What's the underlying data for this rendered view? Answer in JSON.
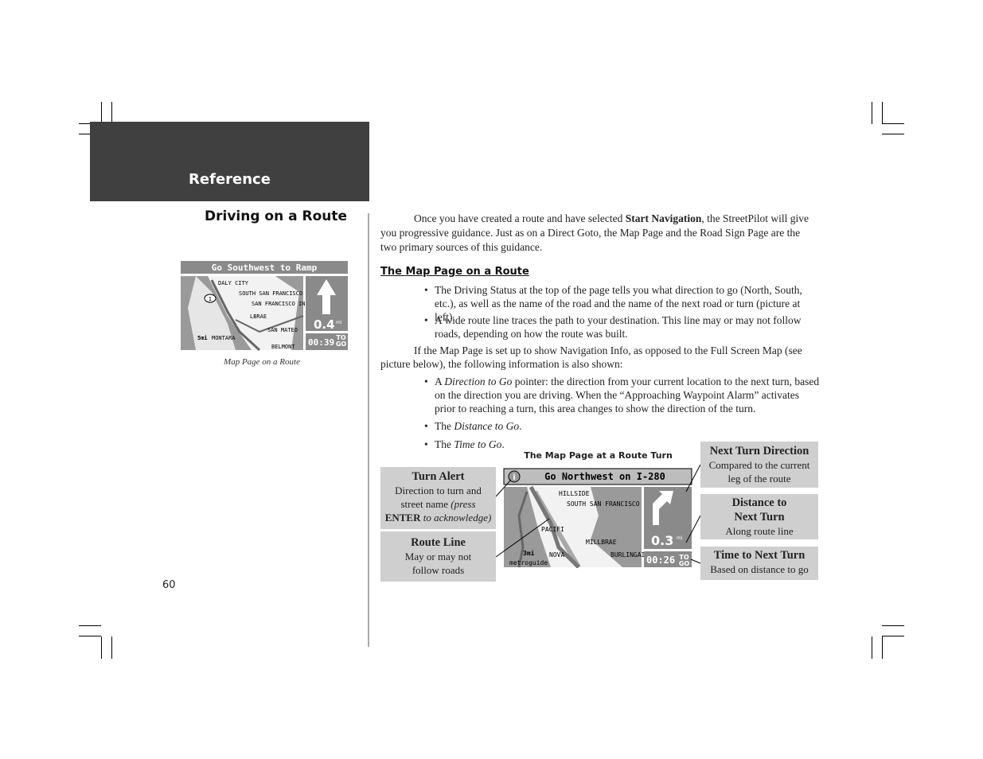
{
  "header": {
    "section": "Reference"
  },
  "left": {
    "title": "Driving on a Route",
    "figure": {
      "banner": "Go Southwest to Ramp",
      "distance": "0.4",
      "distance_unit": "mi",
      "time": "00:39",
      "time_unit": "TO GO",
      "scale": "5mi",
      "labels": [
        "DALY CITY",
        "SOUTH SAN FRANCISCO",
        "SAN FRANCISCO IN",
        "LBRAE",
        "SAN MATEO",
        "MONTARA",
        "BELMONT",
        "1"
      ]
    },
    "caption": "Map Page on a Route",
    "page_number": "60"
  },
  "main": {
    "intro": {
      "pre": "Once you have created a route and have selected ",
      "bold": "Start Navigation",
      "post": ", the StreetPilot will give you progressive guidance.  Just as on a Direct Goto, the Map Page and the Road Sign Page are the two primary sources of this guidance."
    },
    "subhead": "The Map Page on a Route",
    "bullets1": [
      "The Driving Status at the top of the page tells you what direction to go (North, South, etc.), as well as the name of the road and the name of the next road or turn (picture at left).",
      "A wide route line traces the path to your destination.  This line may or may not follow roads, depending on how the route was built."
    ],
    "para2": "If the Map Page is set up to show Navigation Info, as opposed to the Full Screen Map (see picture below), the following information is also shown:",
    "bullet_dir": {
      "pre": "A ",
      "em": "Direction to Go",
      "post": " pointer: the direction from your current location to the next turn, based on the direction you are driving.  When the “Approaching Waypoint Alarm” activates prior to reaching a turn, this area changes to show the direction of the turn."
    },
    "bullet_dist": {
      "pre": "The ",
      "em": "Distance to Go",
      "post": "."
    },
    "bullet_time": {
      "pre": "The ",
      "em": "Time to Go",
      "post": "."
    },
    "figure": {
      "title": "The Map Page at a Route Turn",
      "banner": "Go Northwest on I-280",
      "distance": "0.3",
      "distance_unit": "mi",
      "time": "00:26",
      "time_unit": "TO GO",
      "scale": "3mi",
      "brand": "metroguide",
      "labels": [
        "HILLSIDE",
        "SOUTH SAN FRANCISCO",
        "PACIFI",
        "MILLBRAE",
        "NOVA",
        "BURLINGAI"
      ]
    },
    "callouts": {
      "turn_alert": {
        "title": "Turn Alert",
        "l1": "Direction to turn and",
        "l2a": "street name ",
        "l2b": "(press",
        "l3a": "ENTER",
        "l3b": " to acknowledge)"
      },
      "route_line": {
        "title": "Route Line",
        "l1": "May or may not",
        "l2": "follow roads"
      },
      "next_turn": {
        "title": "Next Turn Direction",
        "l1": "Compared to the current",
        "l2": "leg of the route"
      },
      "distance": {
        "title1": "Distance to",
        "title2": "Next Turn",
        "l1": "Along route line"
      },
      "time": {
        "title": "Time to Next Turn",
        "l1": "Based on distance to go"
      }
    }
  }
}
